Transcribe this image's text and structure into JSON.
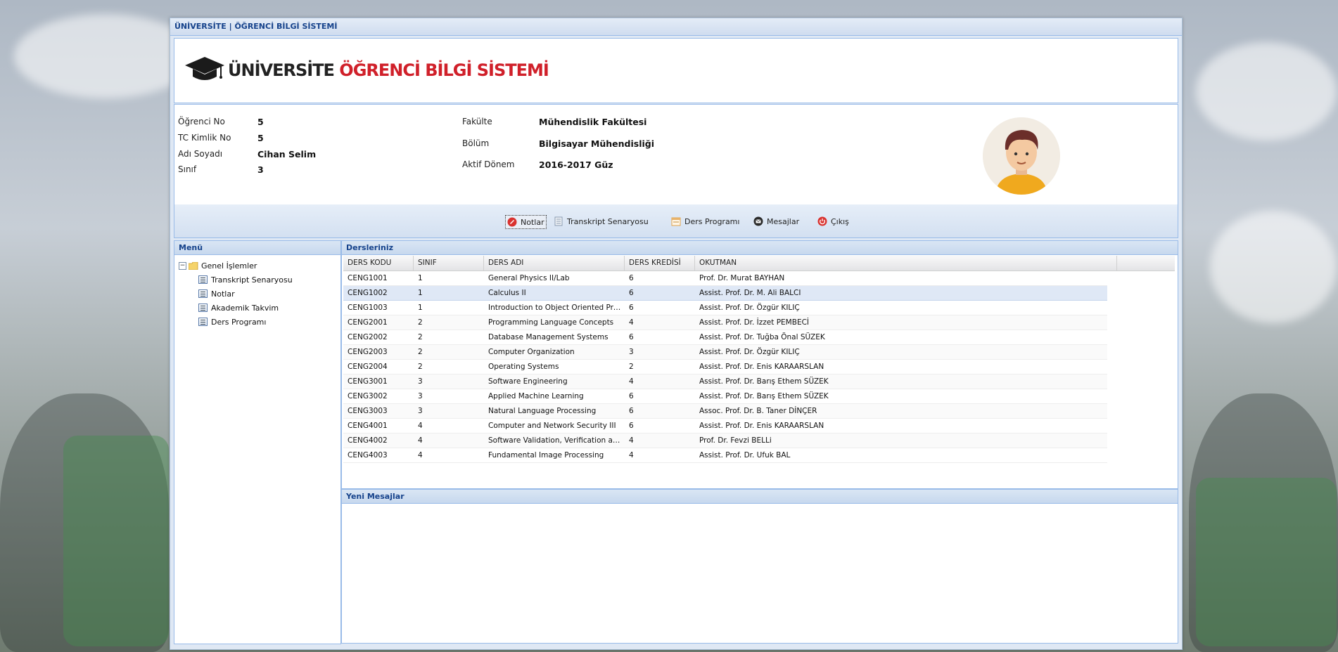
{
  "app": {
    "title": "ÜNİVERSİTE | ÖĞRENCİ BİLGİ SİSTEMİ"
  },
  "logo": {
    "text_dark": "ÜNİVERSİTE",
    "text_red": "ÖĞRENCİ BİLGİ SİSTEMİ"
  },
  "student": {
    "no_label": "Öğrenci No",
    "no": "5",
    "tc_label": "TC Kimlik No",
    "tc": "5",
    "name_label": "Adı Soyadı",
    "name": "Cihan Selim",
    "class_label": "Sınıf",
    "class": "3",
    "faculty_label": "Fakülte",
    "faculty": "Mühendislik Fakültesi",
    "dept_label": "Bölüm",
    "dept": "Bilgisayar Mühendisliği",
    "term_label": "Aktif Dönem",
    "term": "2016-2017 Güz"
  },
  "toolbar": {
    "notlar": "Notlar",
    "transkript": "Transkript Senaryosu",
    "program": "Ders Programı",
    "mesajlar": "Mesajlar",
    "cikis": "Çıkış"
  },
  "menu": {
    "header": "Menü",
    "root": "Genel İşlemler",
    "items": [
      "Transkript Senaryosu",
      "Notlar",
      "Akademik Takvim",
      "Ders Programı"
    ]
  },
  "courses": {
    "header": "Dersleriniz",
    "columns": [
      "DERS KODU",
      "SINIF",
      "DERS ADI",
      "DERS KREDİSİ",
      "OKUTMAN"
    ],
    "rows": [
      [
        "CENG1001",
        "1",
        "General Physics II/Lab",
        "6",
        "Prof. Dr. Murat BAYHAN"
      ],
      [
        "CENG1002",
        "1",
        "Calculus II",
        "6",
        "Assist. Prof. Dr. M. Ali BALCI"
      ],
      [
        "CENG1003",
        "1",
        "Introduction to Object Oriented Prog...",
        "6",
        "Assist. Prof. Dr. Özgür KILIÇ"
      ],
      [
        "CENG2001",
        "2",
        "Programming Language Concepts",
        "4",
        "Assist. Prof. Dr. İzzet PEMBECİ"
      ],
      [
        "CENG2002",
        "2",
        "Database Management Systems",
        "6",
        "Assist. Prof. Dr. Tuğba Önal SÜZEK"
      ],
      [
        "CENG2003",
        "2",
        "Computer Organization",
        "3",
        "Assist. Prof. Dr. Özgür KILIÇ"
      ],
      [
        "CENG2004",
        "2",
        "Operating Systems",
        "2",
        "Assist. Prof. Dr. Enis KARAARSLAN"
      ],
      [
        "CENG3001",
        "3",
        "Software Engineering",
        "4",
        "Assist. Prof. Dr. Barış Ethem SÜZEK"
      ],
      [
        "CENG3002",
        "3",
        "Applied Machine Learning",
        "6",
        "Assist. Prof. Dr. Barış Ethem SÜZEK"
      ],
      [
        "CENG3003",
        "3",
        "Natural Language Processing",
        "6",
        "Assoc. Prof. Dr. B. Taner DİNÇER"
      ],
      [
        "CENG4001",
        "4",
        "Computer and Network Security III",
        "6",
        "Assist. Prof. Dr. Enis KARAARSLAN"
      ],
      [
        "CENG4002",
        "4",
        "Software Validation, Verification and...",
        "4",
        "Prof. Dr. Fevzi BELLi"
      ],
      [
        "CENG4003",
        "4",
        "Fundamental Image Processing",
        "4",
        "Assist. Prof. Dr. Ufuk BAL"
      ]
    ]
  },
  "messages": {
    "header": "Yeni Mesajlar"
  },
  "colors": {
    "header_text": "#15428b",
    "brand_red": "#d0202a",
    "panel_border": "#99bbe8"
  }
}
